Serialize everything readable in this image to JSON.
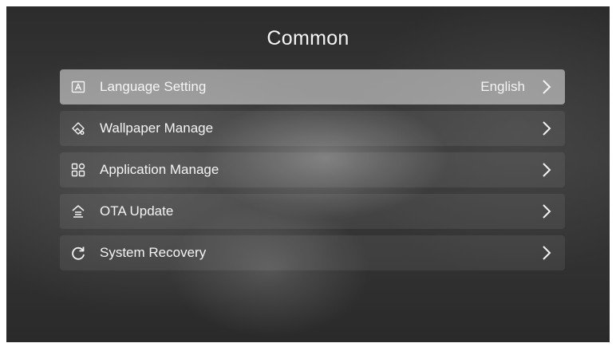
{
  "header": {
    "title": "Common"
  },
  "menu": {
    "items": [
      {
        "label": "Language Setting",
        "value": "English",
        "icon": "language-icon",
        "selected": true
      },
      {
        "label": "Wallpaper Manage",
        "value": "",
        "icon": "wallpaper-icon",
        "selected": false
      },
      {
        "label": "Application Manage",
        "value": "",
        "icon": "apps-grid-icon",
        "selected": false
      },
      {
        "label": "OTA Update",
        "value": "",
        "icon": "ota-update-icon",
        "selected": false
      },
      {
        "label": "System Recovery",
        "value": "",
        "icon": "recovery-icon",
        "selected": false
      }
    ]
  },
  "colors": {
    "text": "#f4f4f4",
    "selected_background": "#9a9a9a",
    "background": "#2f2f2f"
  }
}
